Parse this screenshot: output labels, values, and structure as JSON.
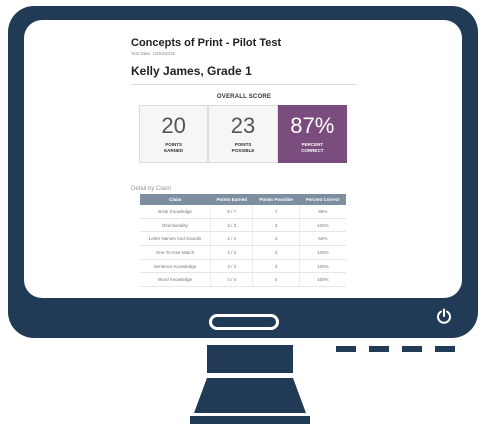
{
  "report": {
    "title": "Concepts of Print - Pilot Test",
    "test_date": "Test Date: 10/04/2016",
    "student": "Kelly James, Grade 1",
    "overall_title": "OVERALL SCORE",
    "scores": [
      {
        "value": "20",
        "label_line1": "POINTS",
        "label_line2": "EARNED"
      },
      {
        "value": "23",
        "label_line1": "POINTS",
        "label_line2": "POSSIBLE"
      },
      {
        "value": "87%",
        "label_line1": "PERCENT",
        "label_line2": "CORRECT"
      }
    ],
    "detail_title": "Detail by Claim",
    "table": {
      "headers": [
        "Claim",
        "Points Earned",
        "Points Possible",
        "Percent Correct"
      ],
      "rows": [
        [
          "Book Knowledge",
          "6 / 7",
          "7",
          "86%"
        ],
        [
          "Directionality",
          "3 / 3",
          "3",
          "100%"
        ],
        [
          "Letter Names And Sounds",
          "2 / 4",
          "4",
          "50%"
        ],
        [
          "One-To-One Match",
          "2 / 2",
          "2",
          "100%"
        ],
        [
          "Sentence Knowledge",
          "3 / 3",
          "3",
          "100%"
        ],
        [
          "Word Knowledge",
          "4 / 4",
          "4",
          "100%"
        ]
      ]
    }
  },
  "colors": {
    "monitor": "#213a55",
    "accent": "#7a4d7e",
    "table_header": "#7d8ea1"
  },
  "icons": {
    "power": "power-icon"
  }
}
